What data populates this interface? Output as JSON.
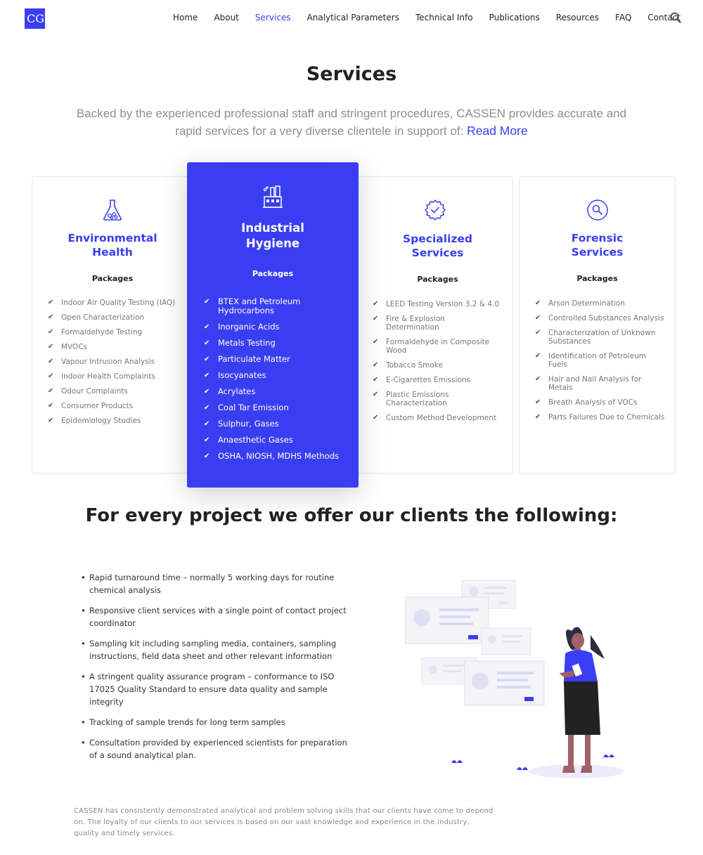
{
  "header": {
    "logo_text": "CG",
    "nav": [
      {
        "label": "Home",
        "active": false
      },
      {
        "label": "About",
        "active": false
      },
      {
        "label": "Services",
        "active": true
      },
      {
        "label": "Analytical Parameters",
        "active": false
      },
      {
        "label": "Technical Info",
        "active": false
      },
      {
        "label": "Publications",
        "active": false
      },
      {
        "label": "Resources",
        "active": false
      },
      {
        "label": "FAQ",
        "active": false
      },
      {
        "label": "Contact",
        "active": false
      }
    ],
    "search_icon": "search-icon"
  },
  "page_title": "Services",
  "intro": {
    "text": "Backed by the experienced professional staff and stringent procedures, CASSEN provides accurate and rapid services for a very diverse clientele in support of:",
    "read_more": "Read More"
  },
  "colors": {
    "accent": "#3a3ef2"
  },
  "cards": [
    {
      "title_line1": "Environmental",
      "title_line2": "Health",
      "icon": "flask-icon",
      "packages_label": "Packages",
      "items": [
        "Indoor Air Quality Testing (IAQ)",
        "Open Characterization",
        "Formaldehyde Testing",
        "MVOCs",
        "Vapour Intrusion Analysis",
        "Indoor Health Complaints",
        "Odour Complaints",
        "Consumer Products",
        "Epidemiology Studies"
      ]
    },
    {
      "title_line1": "Industrial",
      "title_line2": "Hygiene",
      "icon": "factory-icon",
      "packages_label": "Packages",
      "items": [
        "BTEX and Petroleum Hydrocarbons",
        "Inorganic Acids",
        "Metals Testing",
        "Particulate Matter",
        "Isocyanates",
        "Acrylates",
        "Coal Tar Emission",
        "Sulphur, Gases",
        "Anaesthetic Gases",
        "OSHA, NIOSH, MDHS Methods"
      ]
    },
    {
      "title_line1": "Specialized",
      "title_line2": "Services",
      "icon": "badge-check-icon",
      "packages_label": "Packages",
      "items": [
        "LEED Testing Version 3.2 & 4.0",
        "Fire & Explosion Determination",
        "Formaldehyde in Composite Wood",
        "Tobacco Smoke",
        "E-Cigarettes Emissions",
        "Plastic Emissions Characterization",
        "Custom Method Development"
      ]
    },
    {
      "title_line1": "Forensic",
      "title_line2": "Services",
      "icon": "magnifier-icon",
      "packages_label": "Packages",
      "items": [
        "Arson Determination",
        "Controlled Substances Analysis",
        "Characterization of Unknown Substances",
        "Identification of Petroleum Fuels",
        "Hair and Nail Analysis for Metals",
        "Breath Analysis of VOCs",
        "Parts Failures Due to Chemicals"
      ]
    }
  ],
  "offer": {
    "title": "For every project we offer our clients the following:",
    "items": [
      "Rapid turnaround time – normally 5 working days for routine chemical analysis",
      "Responsive client services with a single point of contact project coordinator",
      "Sampling kit including sampling media, containers, sampling instructions, field data sheet and other relevant information",
      "A stringent quality assurance program – conformance to ISO 17025 Quality Standard to ensure data quality and sample integrity",
      "Tracking of sample trends for long term samples",
      "Consultation provided by experienced scientists for preparation of a sound analytical plan."
    ]
  },
  "closing": "CASSEN has consistently demonstrated analytical and problem solving skills that our clients have come to depend on. The loyalty of our clients to our services is based on our vast knowledge and experience in the industry, quality and timely services."
}
